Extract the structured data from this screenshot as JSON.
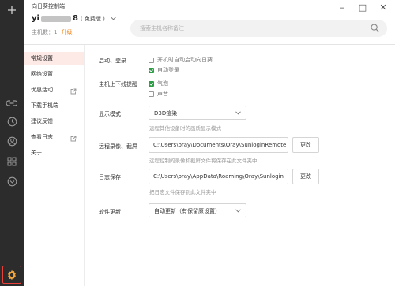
{
  "window": {
    "title": "向日葵控制端",
    "minimize": "–",
    "maximize": "□",
    "close": "✕"
  },
  "account": {
    "name_start": "yi",
    "name_end": "8",
    "edition": "( 免费版 )",
    "hosts_label": "主机数：1",
    "upgrade": "升级"
  },
  "search": {
    "placeholder": "搜索主机名称备注"
  },
  "sidebar_icons": [
    "add-icon",
    "link-icon",
    "clock-icon",
    "user-icon",
    "grid-icon",
    "box-icon",
    "gear-icon"
  ],
  "menu": [
    {
      "label": "常规设置",
      "active": true,
      "external": false
    },
    {
      "label": "网络设置",
      "active": false,
      "external": false
    },
    {
      "label": "优惠活动",
      "active": false,
      "external": true
    },
    {
      "label": "下载手机端",
      "active": false,
      "external": false
    },
    {
      "label": "建议反馈",
      "active": false,
      "external": false
    },
    {
      "label": "查看日志",
      "active": false,
      "external": true
    },
    {
      "label": "关于",
      "active": false,
      "external": false
    }
  ],
  "settings": {
    "startup": {
      "label": "启动、登录",
      "opt1": "开机时自动启动向日葵",
      "opt1_checked": false,
      "opt2": "自动登录",
      "opt2_checked": true
    },
    "online_alert": {
      "label": "主机上下线提醒",
      "opt1": "气泡",
      "opt1_checked": true,
      "opt2": "声音",
      "opt2_checked": false
    },
    "display": {
      "label": "显示模式",
      "value": "D3D渲染",
      "hint": "远程其他设备时的画质显示模式"
    },
    "recording": {
      "label": "远程录像、截屏",
      "path": "C:\\Users\\oray\\Documents\\Oray\\SunloginRemote",
      "button": "更改",
      "hint": "远程控制的录像和截屏文件将保存在此文件夹中"
    },
    "log": {
      "label": "日志保存",
      "path": "C:\\Users\\oray\\AppData\\Roaming\\Oray\\Sunlogin",
      "button": "更改",
      "hint": "把日志文件保存到此文件夹中"
    },
    "update": {
      "label": "软件更新",
      "value": "自动更新（有保留原设置）"
    }
  },
  "colors": {
    "accent": "#e8403a",
    "upgrade": "#f08a24",
    "check": "#2e9e46",
    "rail": "#2c2c2c",
    "active_menu": "#fde9e6"
  }
}
